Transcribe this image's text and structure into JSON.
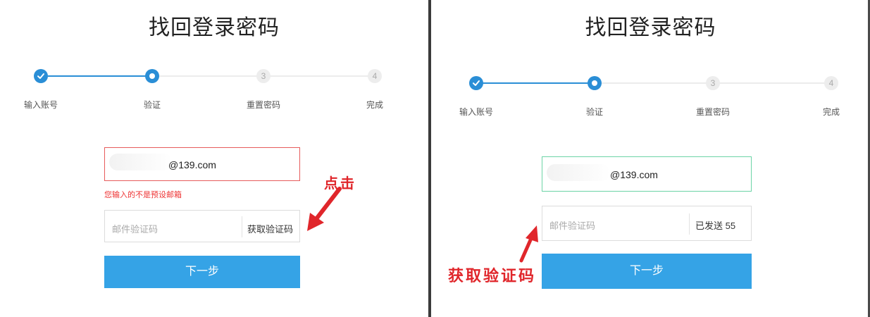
{
  "panels": [
    {
      "title": "找回登录密码",
      "steps": [
        {
          "label": "输入账号",
          "state": "done"
        },
        {
          "label": "验证",
          "state": "current"
        },
        {
          "label": "重置密码",
          "number": "3",
          "state": "pending"
        },
        {
          "label": "完成",
          "number": "4",
          "state": "pending"
        }
      ],
      "email_suffix": "@139.com",
      "email_state": "error",
      "error_message": "您输入的不是预设邮箱",
      "code_placeholder": "邮件验证码",
      "code_button": "获取验证码",
      "submit_label": "下一步",
      "annotation": "点击"
    },
    {
      "title": "找回登录密码",
      "steps": [
        {
          "label": "输入账号",
          "state": "done"
        },
        {
          "label": "验证",
          "state": "current"
        },
        {
          "label": "重置密码",
          "number": "3",
          "state": "pending"
        },
        {
          "label": "完成",
          "number": "4",
          "state": "pending"
        }
      ],
      "email_suffix": "@139.com",
      "email_state": "valid",
      "code_placeholder": "邮件验证码",
      "code_button": "已发送 55",
      "submit_label": "下一步",
      "annotation": "获取验证码"
    }
  ],
  "colors": {
    "accent": "#2a8ed6",
    "submit": "#35a3e6",
    "error": "#e33333",
    "valid_border": "#6cd4a6",
    "annotation": "#e0262b"
  }
}
